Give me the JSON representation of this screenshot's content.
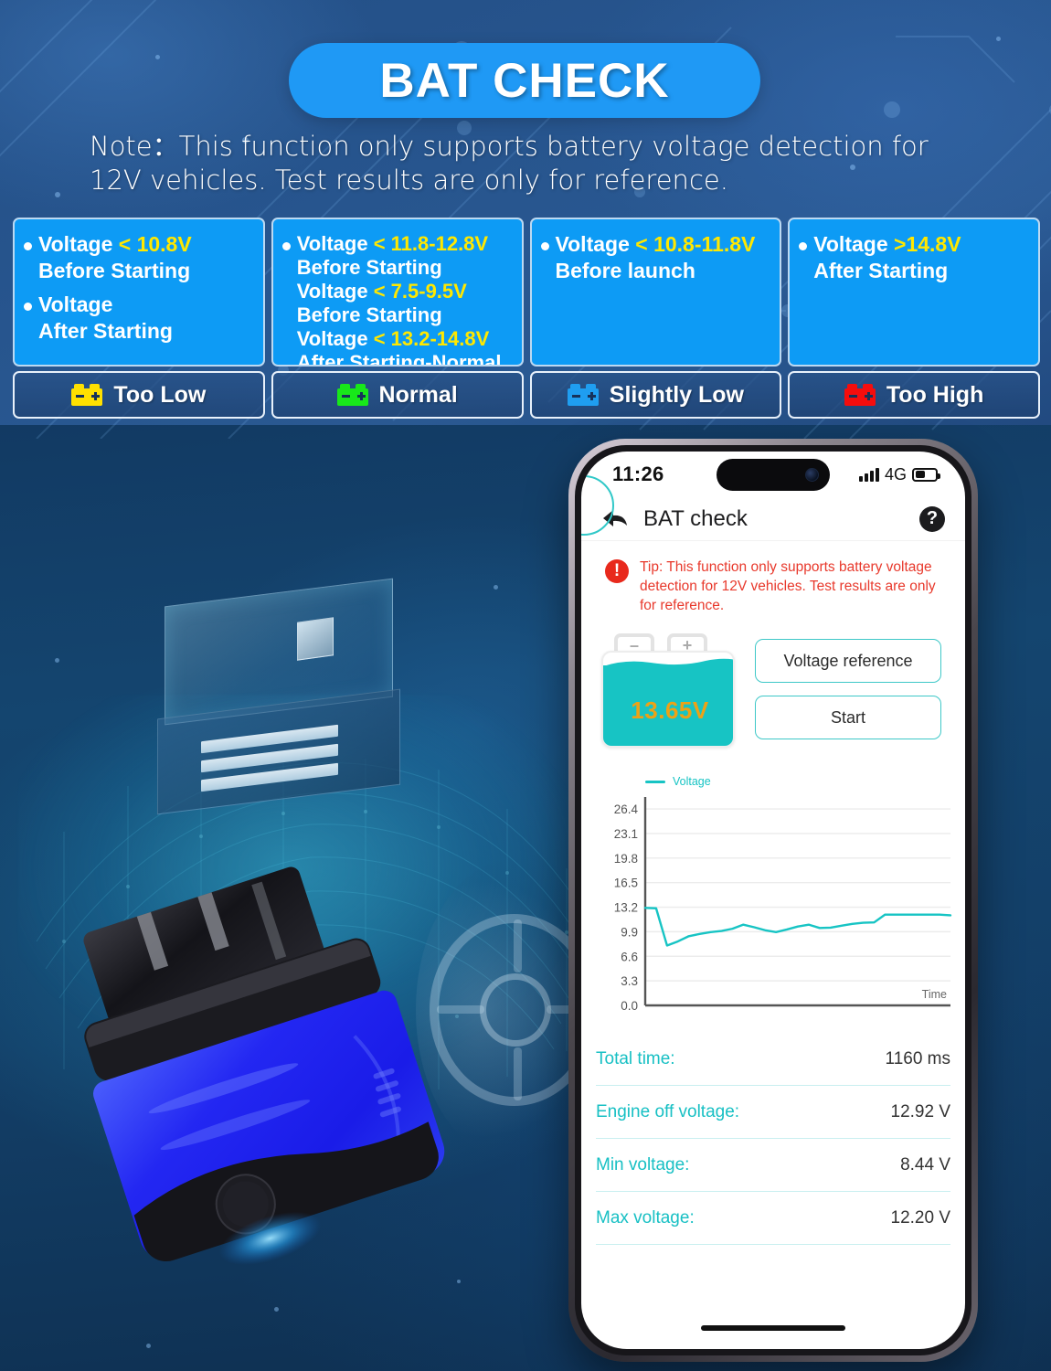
{
  "header": {
    "title": "BAT CHECK",
    "note": "Note：This function only supports battery voltage detection for 12V vehicles. Test results are only for reference.",
    "pill_color": "#1f99f5"
  },
  "info_cards": [
    {
      "status_label": "Too Low",
      "status_color": "#ffe000",
      "icon": "battery-icon",
      "layout": "bulleted",
      "lines": [
        {
          "bullet": true,
          "plain": "Voltage ",
          "highlight": "< 10.8V",
          "tail": ""
        },
        {
          "bullet": false,
          "plain": "Before Starting",
          "highlight": "",
          "tail": ""
        },
        {
          "bullet": true,
          "plain": "Voltage",
          "highlight": "",
          "tail": ""
        },
        {
          "bullet": false,
          "plain": "After Starting",
          "highlight": "",
          "tail": ""
        }
      ]
    },
    {
      "status_label": "Normal",
      "status_color": "#18e81a",
      "icon": "battery-icon",
      "layout": "compact",
      "lines": [
        {
          "bullet": true,
          "plain": "Voltage ",
          "highlight": "< 11.8-12.8V",
          "tail": ""
        },
        {
          "bullet": false,
          "plain": "Before Starting",
          "highlight": "",
          "tail": ""
        },
        {
          "bullet": false,
          "plain": "Voltage ",
          "highlight": "< 7.5-9.5V",
          "tail": ""
        },
        {
          "bullet": false,
          "plain": "Before Starting",
          "highlight": "",
          "tail": ""
        },
        {
          "bullet": false,
          "plain": "Voltage ",
          "highlight": "< 13.2-14.8V",
          "tail": ""
        },
        {
          "bullet": false,
          "plain": "After Starting-Normal",
          "highlight": "",
          "tail": ""
        }
      ]
    },
    {
      "status_label": "Slightly Low",
      "status_color": "#1f9ef0",
      "icon": "battery-icon",
      "layout": "bulleted",
      "lines": [
        {
          "bullet": true,
          "plain": "Voltage ",
          "highlight": "< 10.8-11.8V",
          "tail": ""
        },
        {
          "bullet": false,
          "plain": "Before launch",
          "highlight": "",
          "tail": ""
        }
      ]
    },
    {
      "status_label": "Too High",
      "status_color": "#f50d0d",
      "icon": "battery-icon",
      "layout": "bulleted",
      "lines": [
        {
          "bullet": true,
          "plain": "Voltage ",
          "highlight": ">14.8V",
          "tail": ""
        },
        {
          "bullet": false,
          "plain": "After Starting",
          "highlight": "",
          "tail": ""
        }
      ]
    }
  ],
  "phone": {
    "status_bar": {
      "time": "11:26",
      "network": "4G",
      "signal_bars": 4,
      "battery_percent": 52
    },
    "app_bar": {
      "title": "BAT check",
      "back_icon": "back-arrow-icon",
      "help_icon": "help-icon"
    },
    "tip": {
      "icon": "alert-icon",
      "text": "Tip: This function only supports battery voltage detection for 12V vehicles. Test results are only for reference.",
      "color": "#e8392c"
    },
    "battery_widget": {
      "voltage": "13.65V",
      "minus_label": "–",
      "plus_label": "+",
      "fill_color": "#17c4c4",
      "text_color": "#eda216",
      "fill_level_percent": 83
    },
    "buttons": [
      {
        "label": "Voltage reference"
      },
      {
        "label": "Start"
      }
    ],
    "results": [
      {
        "key": "Total time:",
        "value": "1160 ms"
      },
      {
        "key": "Engine off voltage:",
        "value": "12.92 V"
      },
      {
        "key": "Min voltage:",
        "value": "8.44 V"
      },
      {
        "key": "Max voltage:",
        "value": "12.20 V"
      }
    ],
    "accent_color": "#17c4c4"
  },
  "chart_data": {
    "type": "line",
    "title": "",
    "xlabel": "Time",
    "ylabel": "",
    "grid": true,
    "legend_position": "top-left",
    "ylim": [
      0.0,
      28.0
    ],
    "yticks": [
      0.0,
      3.3,
      6.6,
      9.9,
      13.2,
      16.5,
      19.8,
      23.1,
      26.4
    ],
    "ytick_labels": [
      "0.0",
      "3.3",
      "6.6",
      "9.9",
      "13.2",
      "16.5",
      "19.8",
      "23.1",
      "26.4"
    ],
    "series": [
      {
        "name": "Voltage",
        "color": "#17c4c4",
        "x": [
          0,
          1,
          2,
          3,
          4,
          5,
          6,
          7,
          8,
          9,
          10,
          11,
          12,
          13,
          14,
          15,
          16,
          17,
          18,
          19,
          20,
          21,
          22,
          23,
          24,
          25,
          26,
          27,
          28
        ],
        "values": [
          13.1,
          13.05,
          8.05,
          8.6,
          9.3,
          9.6,
          9.85,
          10.0,
          10.3,
          10.85,
          10.5,
          10.1,
          9.85,
          10.2,
          10.6,
          10.85,
          10.4,
          10.45,
          10.7,
          10.95,
          11.1,
          11.15,
          12.2,
          12.2,
          12.2,
          12.2,
          12.2,
          12.2,
          12.1
        ]
      }
    ]
  }
}
